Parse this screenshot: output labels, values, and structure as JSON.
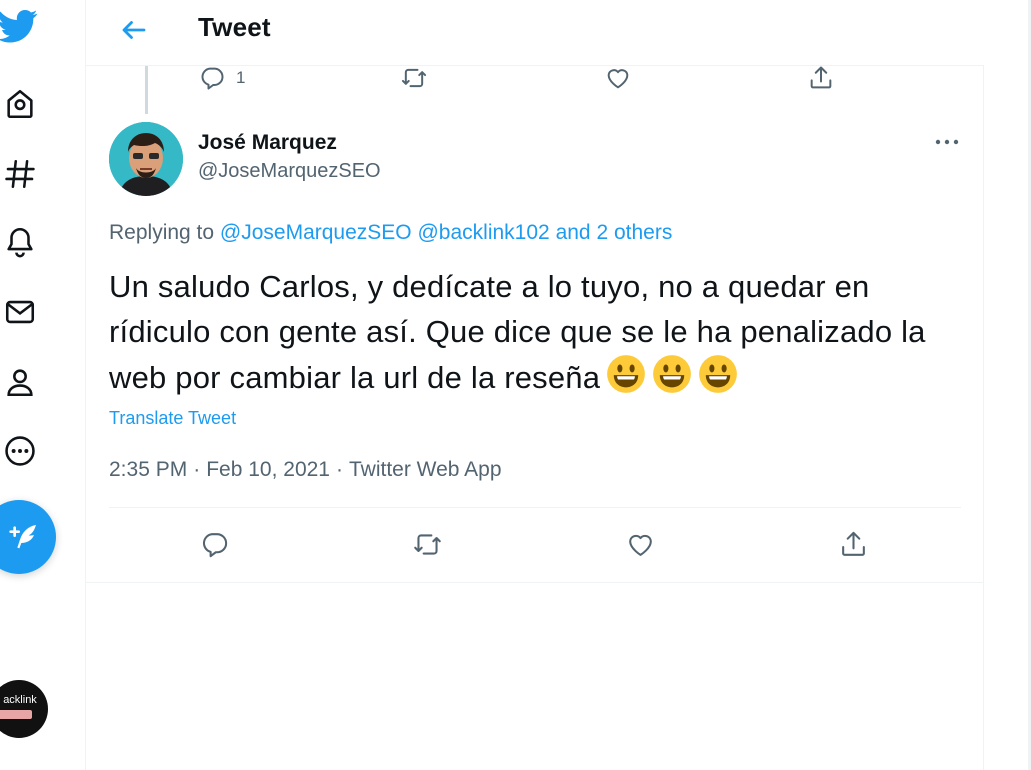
{
  "header": {
    "title": "Tweet"
  },
  "previous_tweet_actions": {
    "reply_count": "1"
  },
  "tweet": {
    "author_name": "José Marquez",
    "author_handle": "@JoseMarquezSEO",
    "replying_label": "Replying to",
    "replying_to": [
      "@JoseMarquezSEO",
      "@backlink102"
    ],
    "replying_joiner": "and",
    "replying_others": "2 others",
    "text": "Un saludo Carlos, y dedícate a lo tuyo, no a quedar en rídiculo con gente así. Que dice que se le ha penalizado la web por cambiar la url de la reseña",
    "emoji_count": 3,
    "translate_label": "Translate Tweet",
    "time": "2:35 PM",
    "date": "Feb 10, 2021",
    "source": "Twitter Web App",
    "separator": "·"
  },
  "sidebar": {
    "profile_avatar_text": "acklink"
  },
  "icons": {
    "nav": [
      "twitter-logo-icon",
      "home-icon",
      "explore-hashtag-icon",
      "notifications-bell-icon",
      "messages-envelope-icon",
      "profile-person-icon",
      "more-circle-icon",
      "compose-feather-icon"
    ],
    "actions": [
      "reply-icon",
      "retweet-icon",
      "like-heart-icon",
      "share-icon"
    ]
  },
  "colors": {
    "accent": "#1d9bf0",
    "text": "#0f1419",
    "secondary": "#536471",
    "border": "#eff3f4"
  }
}
